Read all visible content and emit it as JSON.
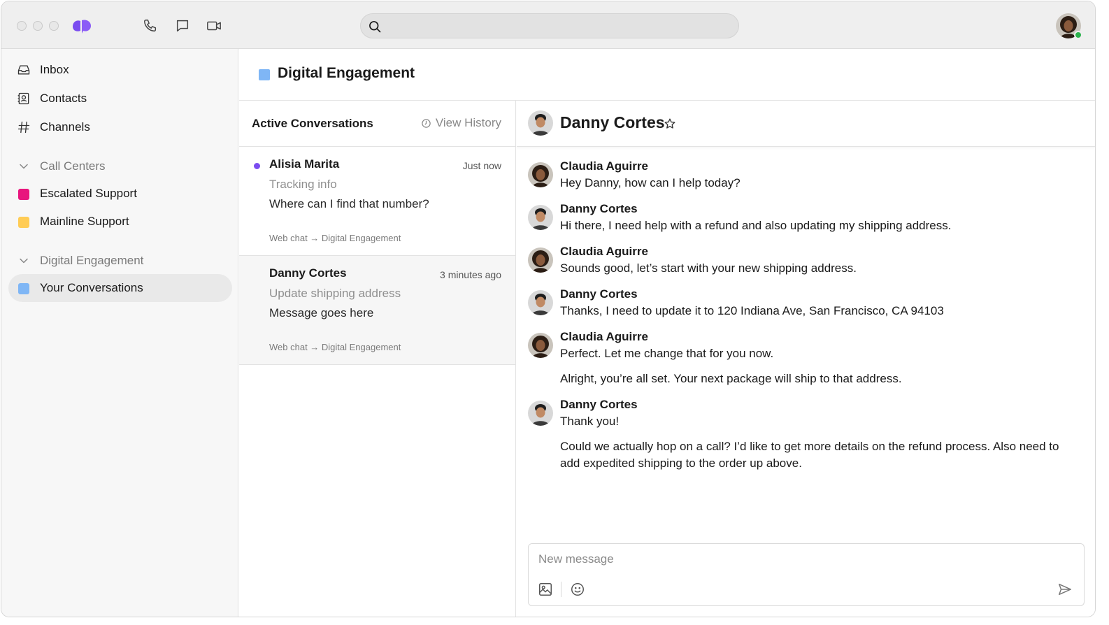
{
  "colors": {
    "accent": "#7a4cf0",
    "escalated": "#e8157d",
    "mainline": "#ffcc55",
    "digital": "#7fb6f5",
    "online": "#2bb24c"
  },
  "titlebar": {
    "icons": [
      "phone-icon",
      "chat-icon",
      "video-icon"
    ],
    "search": {
      "placeholder": "",
      "value": ""
    }
  },
  "sidebar": {
    "items": [
      {
        "label": "Inbox",
        "icon": "inbox-icon"
      },
      {
        "label": "Contacts",
        "icon": "contacts-icon"
      },
      {
        "label": "Channels",
        "icon": "hash-icon"
      }
    ],
    "sections": [
      {
        "label": "Call Centers",
        "items": [
          {
            "label": "Escalated Support",
            "color": "#e8157d"
          },
          {
            "label": "Mainline Support",
            "color": "#ffcc55"
          }
        ]
      },
      {
        "label": "Digital Engagement",
        "items": [
          {
            "label": "Your Conversations",
            "color": "#7fb6f5",
            "active": true
          }
        ]
      }
    ]
  },
  "main": {
    "title": "Digital Engagement"
  },
  "conversations": {
    "header": "Active Conversations",
    "view_history": "View History",
    "items": [
      {
        "name": "Alisia Marita",
        "time": "Just now",
        "subject": "Tracking info",
        "message": "Where can I find that number?",
        "route": "Web chat → Digital Engagement",
        "unread": true
      },
      {
        "name": "Danny Cortes",
        "time": "3 minutes ago",
        "subject": "Update shipping address",
        "message": "Message goes here",
        "route": "Web chat → Digital Engagement",
        "selected": true
      }
    ]
  },
  "chat": {
    "contact": "Danny Cortes",
    "messages": [
      {
        "author": "Claudia Aguirre",
        "lines": [
          "Hey Danny, how can I help today?"
        ]
      },
      {
        "author": "Danny Cortes",
        "lines": [
          "Hi there, I need help with a refund and also updating my shipping address."
        ]
      },
      {
        "author": "Claudia Aguirre",
        "lines": [
          "Sounds good, let’s start with your new shipping address."
        ]
      },
      {
        "author": "Danny Cortes",
        "lines": [
          "Thanks, I need to update it to 120 Indiana Ave, San Francisco, CA 94103"
        ]
      },
      {
        "author": "Claudia Aguirre",
        "lines": [
          "Perfect. Let me change that for you now.",
          "Alright, you’re all set. Your next package will ship to that address."
        ]
      },
      {
        "author": "Danny Cortes",
        "lines": [
          "Thank you!",
          "Could we actually hop on a call? I’d like to get more details on the refund process. Also need to add expedited shipping to the order up above."
        ]
      }
    ],
    "composer": {
      "placeholder": "New message",
      "value": ""
    }
  }
}
